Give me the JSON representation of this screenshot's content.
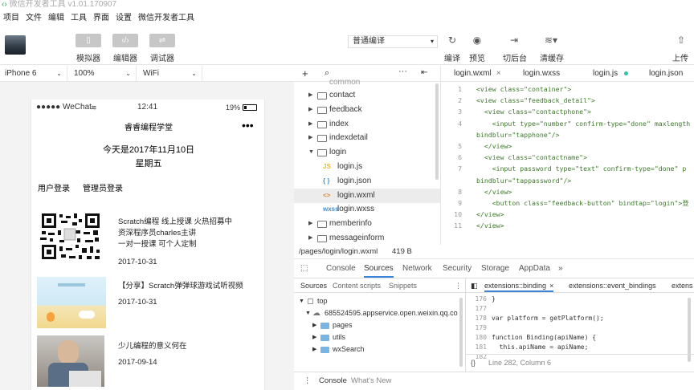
{
  "window": {
    "title": "微信开发者工具 v1.01.170907"
  },
  "menu": [
    "项目",
    "文件",
    "编辑",
    "工具",
    "界面",
    "设置",
    "微信开发者工具"
  ],
  "toolbar": {
    "simulator": "模拟器",
    "editor": "编辑器",
    "debugger": "调试器",
    "compile_mode": "普通编译",
    "compile": "编译",
    "preview": "预览",
    "cut_backend": "切后台",
    "clear_cache": "清缓存",
    "upload": "上传"
  },
  "device_bar": {
    "device": "iPhone 6",
    "zoom": "100%",
    "network": "WiFi"
  },
  "phone": {
    "carrier": "●●●●● WeChat",
    "time": "12:41",
    "battery": "19%",
    "nav_title": "睿睿编程学堂",
    "nav_dots": "•••",
    "date_line": "今天是2017年11月10日",
    "weekday": "星期五",
    "user_login": "用户登录",
    "admin_login": "管理员登录",
    "articles": [
      {
        "title_line1": "Scratch编程  线上授课  火热招募中",
        "title_line2": "资深程序员charles主讲",
        "title_line3": "一对一授课  可个人定制",
        "date": "2017-10-31"
      },
      {
        "title_line1": "【分享】Scratch弹弹球游戏试听视频",
        "date": "2017-10-31"
      },
      {
        "title_line1": "少儿编程的意义何在",
        "date": "2017-09-14"
      }
    ]
  },
  "file_tree": {
    "partial_top": "common",
    "items": [
      {
        "name": "contact",
        "type": "folder"
      },
      {
        "name": "feedback",
        "type": "folder"
      },
      {
        "name": "index",
        "type": "folder"
      },
      {
        "name": "indexdetail",
        "type": "folder"
      },
      {
        "name": "login",
        "type": "folder-open"
      },
      {
        "name": "login.js",
        "type": "file",
        "badge": "JS",
        "color": "#f0b72f"
      },
      {
        "name": "login.json",
        "type": "file",
        "badge": "{ }",
        "color": "#3b8fd9"
      },
      {
        "name": "login.wxml",
        "type": "file",
        "badge": "<>",
        "color": "#e38533"
      },
      {
        "name": "login.wxss",
        "type": "file",
        "badge": "wxss",
        "color": "#3b8fd9"
      },
      {
        "name": "memberinfo",
        "type": "folder"
      },
      {
        "name": "messageinform",
        "type": "folder"
      }
    ]
  },
  "editor": {
    "tabs": [
      "login.wxml",
      "login.wxss",
      "login.js",
      "login.json"
    ],
    "lines": [
      {
        "n": "1",
        "text": "<view class=\"container\">"
      },
      {
        "n": "2",
        "text": "<view class=\"feedback_detail\">"
      },
      {
        "n": "3",
        "text": "  <view class=\"contactphone\">"
      },
      {
        "n": "4",
        "text": "    <input type=\"number\" confirm-type=\"done\" maxlength"
      },
      {
        "n": "",
        "text": "bindblur=\"tapphone\"/>"
      },
      {
        "n": "5",
        "text": "  </view>"
      },
      {
        "n": "6",
        "text": "  <view class=\"contactname\">"
      },
      {
        "n": "7",
        "text": "    <input password type=\"text\" confirm-type=\"done\" p"
      },
      {
        "n": "",
        "text": "bindblur=\"tappassword\"/>"
      },
      {
        "n": "8",
        "text": "  </view>"
      },
      {
        "n": "9",
        "text": "    <button class=\"feedback-button\" bindtap=\"login\">登"
      },
      {
        "n": "10",
        "text": "</view>"
      },
      {
        "n": "11",
        "text": "</view>"
      }
    ]
  },
  "path_bar": {
    "path": "/pages/login/login.wxml",
    "size": "419 B"
  },
  "devtools": {
    "tabs": [
      "Console",
      "Sources",
      "Network",
      "Security",
      "Storage",
      "AppData",
      "»"
    ],
    "subtabs": [
      "Sources",
      "Content scripts",
      "Snippets"
    ],
    "source_tree": [
      "top",
      "685524595.appservice.open.weixin.qq.co",
      "pages",
      "utils",
      "wxSearch"
    ],
    "file_tabs": [
      "extensions::binding",
      "extensions::event_bindings",
      "extens"
    ],
    "js_lines": [
      {
        "n": "176",
        "text": "}"
      },
      {
        "n": "177",
        "text": ""
      },
      {
        "n": "178",
        "text": "var platform = getPlatform();"
      },
      {
        "n": "179",
        "text": ""
      },
      {
        "n": "180",
        "text": "function Binding(apiName) {"
      },
      {
        "n": "181",
        "text": "  this.apiName = apiName;"
      },
      {
        "n": "182",
        "text": ""
      }
    ],
    "cursor": "Line 282, Column 6",
    "drawer_tabs": [
      "Console",
      "What's New"
    ]
  },
  "colors": {
    "accent_green": "#2ba245",
    "button_gray": "#c7c7c7"
  }
}
